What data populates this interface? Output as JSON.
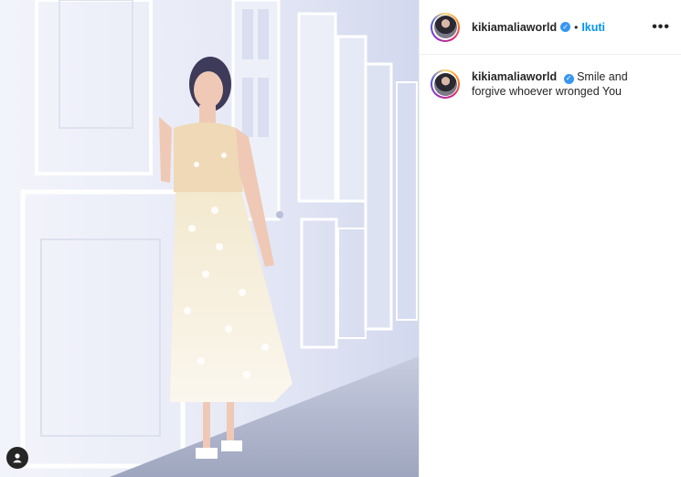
{
  "post": {
    "username": "kikiamaliaworld",
    "follow_label": "Ikuti",
    "separator": "•",
    "more_label": "•••",
    "caption": "Smile and forgive whoever wronged You",
    "verified_icon": "verified-badge-icon",
    "tag_icon": "user-tag-icon"
  }
}
